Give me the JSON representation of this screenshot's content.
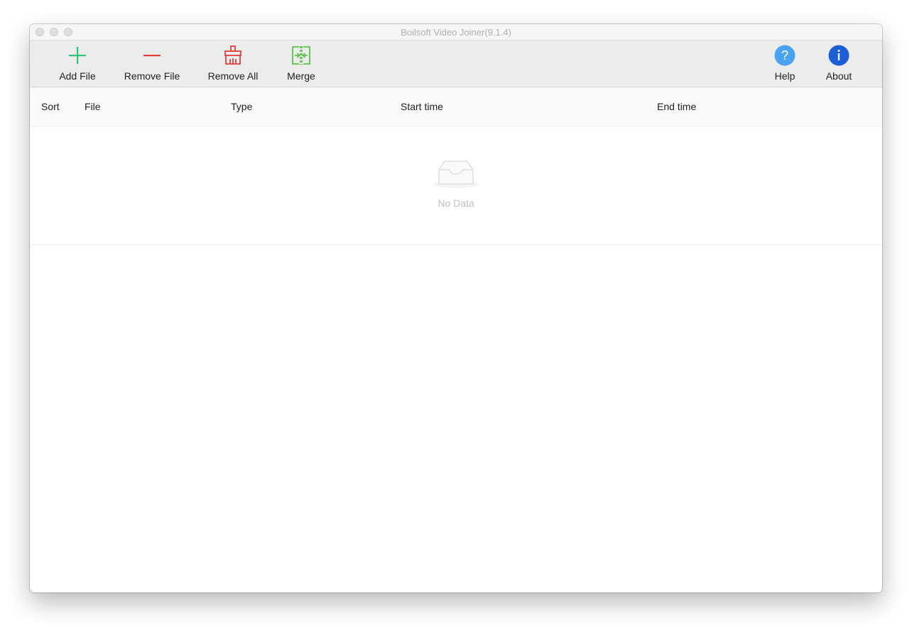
{
  "window": {
    "title": "Boilsoft Video Joiner(9.1.4)"
  },
  "toolbar": {
    "add_file": {
      "label": "Add File",
      "icon": "plus-icon",
      "color": "#2ec27e"
    },
    "remove_file": {
      "label": "Remove File",
      "icon": "minus-icon",
      "color": "#e0403a"
    },
    "remove_all": {
      "label": "Remove All",
      "icon": "broom-icon",
      "color": "#e0403a"
    },
    "merge": {
      "label": "Merge",
      "icon": "merge-icon",
      "color": "#5bc24a"
    },
    "help": {
      "label": "Help",
      "icon": "question-circle-icon",
      "color": "#4aa3f0"
    },
    "about": {
      "label": "About",
      "icon": "info-circle-icon",
      "color": "#1c5fd4"
    }
  },
  "table": {
    "columns": [
      "Sort",
      "File",
      "Type",
      "Start time",
      "End time"
    ],
    "rows": []
  },
  "empty_state": {
    "icon": "empty-inbox-icon",
    "text": "No Data"
  }
}
